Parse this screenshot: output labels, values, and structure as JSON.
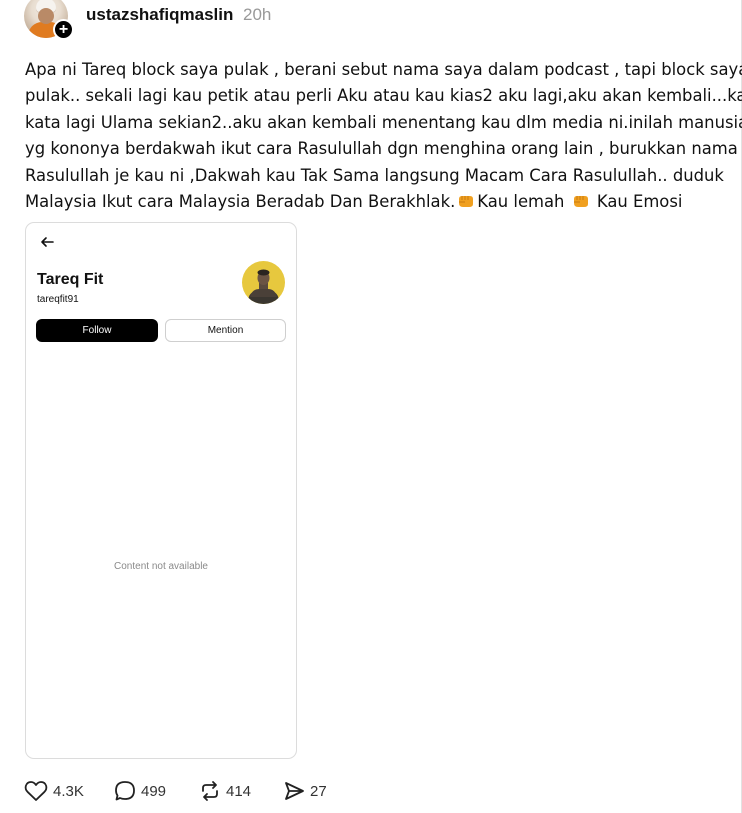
{
  "post": {
    "username": "ustazshafiqmaslin",
    "timestamp": "20h",
    "text_lines": [
      "Apa ni Tareq block saya pulak , berani sebut nama saya dalam podcast , tapi block saya",
      "pulak.. sekali lagi kau petik atau perli Aku atau kau kias2 aku lagi,aku akan kembali...kau",
      "kata lagi Ulama sekian2..aku akan kembali menentang kau dlm media ni.inilah manusia",
      "yg kononya berdakwah ikut cara Rasulullah dgn menghina orang lain , burukkan nama",
      "Rasulullah je kau ni ,Dakwah kau Tak Sama langsung Macam Cara Rasulullah.. duduk",
      "Malaysia Ikut cara Malaysia Beradab Dan Berakhlak."
    ],
    "last_line_tail": {
      "part1": "Kau lemah",
      "part2": "Kau Emosi",
      "emoji_icon": "oncoming-fist-icon"
    }
  },
  "embedded_screenshot": {
    "profile_name": "Tareq Fit",
    "profile_handle": "tareqfit91",
    "follow_label": "Follow",
    "mention_label": "Mention",
    "content_message": "Content not available"
  },
  "actions": {
    "likes": "4.3K",
    "comments": "499",
    "reposts": "414",
    "shares": "27"
  },
  "colors": {
    "profile_pic_bg": "#e7c83e",
    "emoji_fist": "#f0a020",
    "muted_text": "#999999"
  }
}
